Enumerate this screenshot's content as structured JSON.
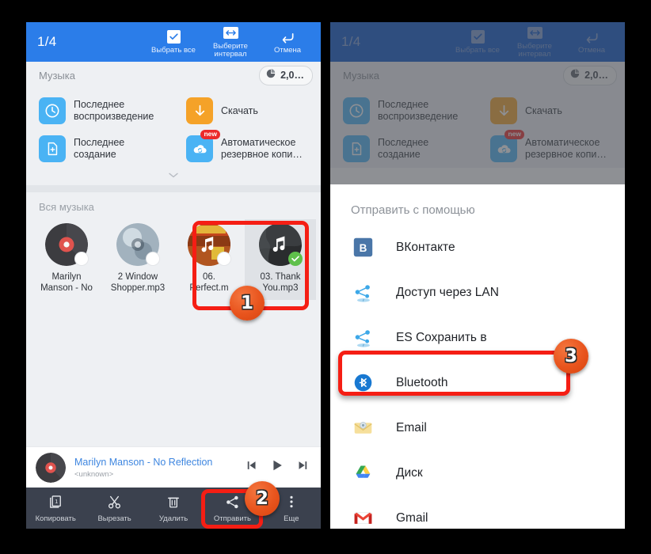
{
  "left_panel": {
    "appbar": {
      "count": "1/4",
      "buttons": [
        {
          "label": "Выбрать все",
          "icon": "checkbox-checked-icon"
        },
        {
          "label": "Выберите\nинтервал",
          "icon": "range-arrows-icon"
        },
        {
          "label": "Отмена",
          "icon": "undo-arrow-icon"
        }
      ],
      "select_all_label": "Выбрать все",
      "select_range_label_1": "Выберите",
      "select_range_label_2": "интервал",
      "cancel_label": "Отмена"
    },
    "section": {
      "title": "Музыка",
      "size_badge": "2,0…",
      "size_badge_icon": "pie-chart-icon"
    },
    "shortcuts": [
      {
        "label_1": "Последнее",
        "label_2": "воспроизведение",
        "icon": "clock-icon",
        "color": "#4ab3f4",
        "badge": ""
      },
      {
        "label_1": "Скачать",
        "label_2": "",
        "icon": "download-arrow-icon",
        "color": "#f5a228",
        "badge": ""
      },
      {
        "label_1": "Последнее",
        "label_2": "создание",
        "icon": "new-file-icon",
        "color": "#4ab3f4",
        "badge": ""
      },
      {
        "label_1": "Автоматическое",
        "label_2": "резервное копи…",
        "icon": "cloud-sync-icon",
        "color": "#4ab3f4",
        "badge": "new"
      }
    ],
    "all_music": {
      "title": "Вся музыка",
      "tiles": [
        {
          "name_1": "Marilyn",
          "name_2": "Manson - No",
          "art": "vinyl-record",
          "selected": false
        },
        {
          "name_1": "2 Window",
          "name_2": "Shopper.mp3",
          "art": "icy-sphere",
          "selected": false
        },
        {
          "name_1": "06.",
          "name_2": "Perfect.m",
          "art": "darkest-cover",
          "selected": false
        },
        {
          "name_1": "03. Thank",
          "name_2": "You.mp3",
          "art": "forest-note",
          "selected": true
        }
      ]
    },
    "now_playing": {
      "title": "Marilyn Manson - No Reflection",
      "subtitle": "<unknown>",
      "prev_icon": "skip-previous-icon",
      "play_icon": "play-icon",
      "next_icon": "skip-next-icon"
    },
    "action_bar": [
      {
        "label": "Копировать",
        "icon": "copy-icon"
      },
      {
        "label": "Вырезать",
        "icon": "scissors-icon"
      },
      {
        "label": "Удалить",
        "icon": "trash-icon"
      },
      {
        "label": "Отправить",
        "icon": "share-icon"
      },
      {
        "label": "Еще",
        "icon": "overflow-dots-icon"
      }
    ]
  },
  "right_panel": {
    "share_sheet": {
      "title": "Отправить с помощью",
      "items": [
        {
          "label": "ВКонтакте",
          "icon": "vkontakte-icon"
        },
        {
          "label": "Доступ через LAN",
          "icon": "es-share-icon"
        },
        {
          "label": "ES Сохранить в",
          "icon": "es-share-icon"
        },
        {
          "label": "Bluetooth",
          "icon": "bluetooth-icon"
        },
        {
          "label": "Email",
          "icon": "email-envelope-icon"
        },
        {
          "label": "Диск",
          "icon": "google-drive-icon"
        },
        {
          "label": "Gmail",
          "icon": "gmail-icon"
        }
      ]
    }
  },
  "annotations": {
    "step_1": "1",
    "step_2": "2",
    "step_3": "3"
  },
  "colors": {
    "appbar_blue": "#2b7de9",
    "action_bar_dark": "#3b414e",
    "panel_bg": "#eef0f3",
    "accent_red": "#f51e14",
    "badge_orange": "#e8541d",
    "selected_green": "#5fc04b",
    "link_blue": "#3e86e0"
  }
}
